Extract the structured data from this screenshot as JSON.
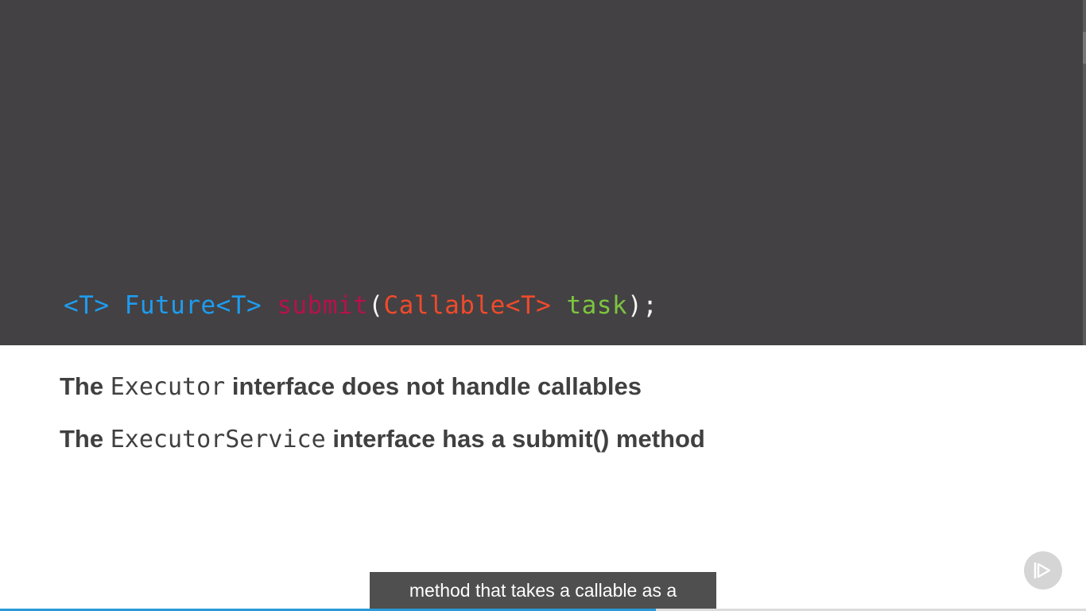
{
  "code": {
    "generic": "<T>",
    "return_type": "Future<T>",
    "method": "submit",
    "open_paren": "(",
    "param_type": "Callable<T>",
    "param_name": "task",
    "close": ");"
  },
  "bullets": [
    {
      "prefix": "The",
      "mono": "Executor",
      "suffix": "interface does not handle callables"
    },
    {
      "prefix": "The",
      "mono": "ExecutorService",
      "suffix": "interface has a submit() method"
    }
  ],
  "caption": {
    "text": "method that takes a callable as a"
  },
  "player": {
    "progress": 0.604,
    "accent_color": "#2a9ad8",
    "badge_icon": "play-logo-icon"
  },
  "colors": {
    "code_background": "#434143",
    "generic": "#1e9cf0",
    "method": "#b4124b",
    "param_type": "#f04a2c",
    "param_name": "#7cc43f"
  }
}
